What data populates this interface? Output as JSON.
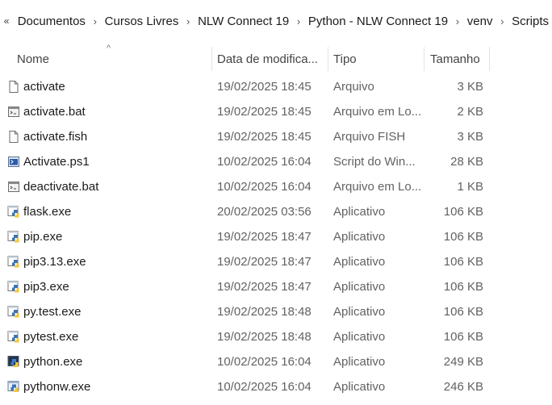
{
  "breadcrumb": {
    "overflow": "«",
    "items": [
      "Documentos",
      "Cursos Livres",
      "NLW Connect 19",
      "Python - NLW Connect 19",
      "venv",
      "Scripts"
    ],
    "separator": "›"
  },
  "columns": {
    "name": "Nome",
    "date": "Data de modifica...",
    "type": "Tipo",
    "size": "Tamanho",
    "sort_indicator": "^"
  },
  "files": [
    {
      "name": "activate",
      "date": "19/02/2025 18:45",
      "type": "Arquivo",
      "size": "3 KB",
      "icon": "file-icon"
    },
    {
      "name": "activate.bat",
      "date": "19/02/2025 18:45",
      "type": "Arquivo em Lo...",
      "size": "2 KB",
      "icon": "batch-file-icon"
    },
    {
      "name": "activate.fish",
      "date": "19/02/2025 18:45",
      "type": "Arquivo FISH",
      "size": "3 KB",
      "icon": "file-icon"
    },
    {
      "name": "Activate.ps1",
      "date": "10/02/2025 16:04",
      "type": "Script do Win...",
      "size": "28 KB",
      "icon": "powershell-script-icon"
    },
    {
      "name": "deactivate.bat",
      "date": "10/02/2025 16:04",
      "type": "Arquivo em Lo...",
      "size": "1 KB",
      "icon": "batch-file-icon"
    },
    {
      "name": "flask.exe",
      "date": "20/02/2025 03:56",
      "type": "Aplicativo",
      "size": "106 KB",
      "icon": "python-exe-icon"
    },
    {
      "name": "pip.exe",
      "date": "19/02/2025 18:47",
      "type": "Aplicativo",
      "size": "106 KB",
      "icon": "python-exe-icon"
    },
    {
      "name": "pip3.13.exe",
      "date": "19/02/2025 18:47",
      "type": "Aplicativo",
      "size": "106 KB",
      "icon": "python-exe-icon"
    },
    {
      "name": "pip3.exe",
      "date": "19/02/2025 18:47",
      "type": "Aplicativo",
      "size": "106 KB",
      "icon": "python-exe-icon"
    },
    {
      "name": "py.test.exe",
      "date": "19/02/2025 18:48",
      "type": "Aplicativo",
      "size": "106 KB",
      "icon": "python-exe-icon"
    },
    {
      "name": "pytest.exe",
      "date": "19/02/2025 18:48",
      "type": "Aplicativo",
      "size": "106 KB",
      "icon": "python-exe-icon"
    },
    {
      "name": "python.exe",
      "date": "10/02/2025 16:04",
      "type": "Aplicativo",
      "size": "249 KB",
      "icon": "python-console-icon"
    },
    {
      "name": "pythonw.exe",
      "date": "10/02/2025 16:04",
      "type": "Aplicativo",
      "size": "246 KB",
      "icon": "python-window-icon"
    }
  ]
}
